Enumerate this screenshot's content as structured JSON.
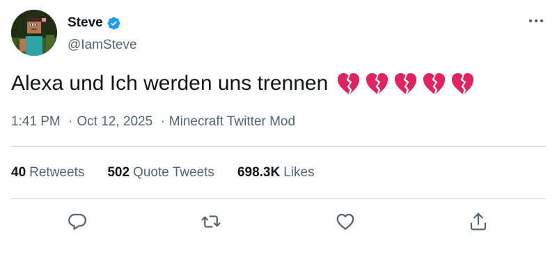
{
  "author": {
    "display_name": "Steve",
    "handle": "@IamSteve",
    "verified": true,
    "avatar_icon": "steve-avatar-icon"
  },
  "tweet": {
    "text": "Alexa und Ich werden uns trennen",
    "emoji": [
      "broken-heart",
      "broken-heart",
      "broken-heart",
      "broken-heart",
      "broken-heart"
    ],
    "time": "1:41 PM",
    "date": "Oct 12, 2025",
    "separator": "·",
    "source": "Minecraft Twitter Mod"
  },
  "stats": [
    {
      "count": "40",
      "label": "Retweets"
    },
    {
      "count": "502",
      "label": "Quote Tweets"
    },
    {
      "count": "698.3K",
      "label": "Likes"
    }
  ],
  "actions": [
    "reply-icon",
    "retweet-icon",
    "like-icon",
    "share-icon"
  ],
  "colors": {
    "text": "#0f1419",
    "secondary": "#536471",
    "divider": "#cfd9de",
    "verified": "#1d9bf0",
    "broken_heart": "#e0245e"
  }
}
